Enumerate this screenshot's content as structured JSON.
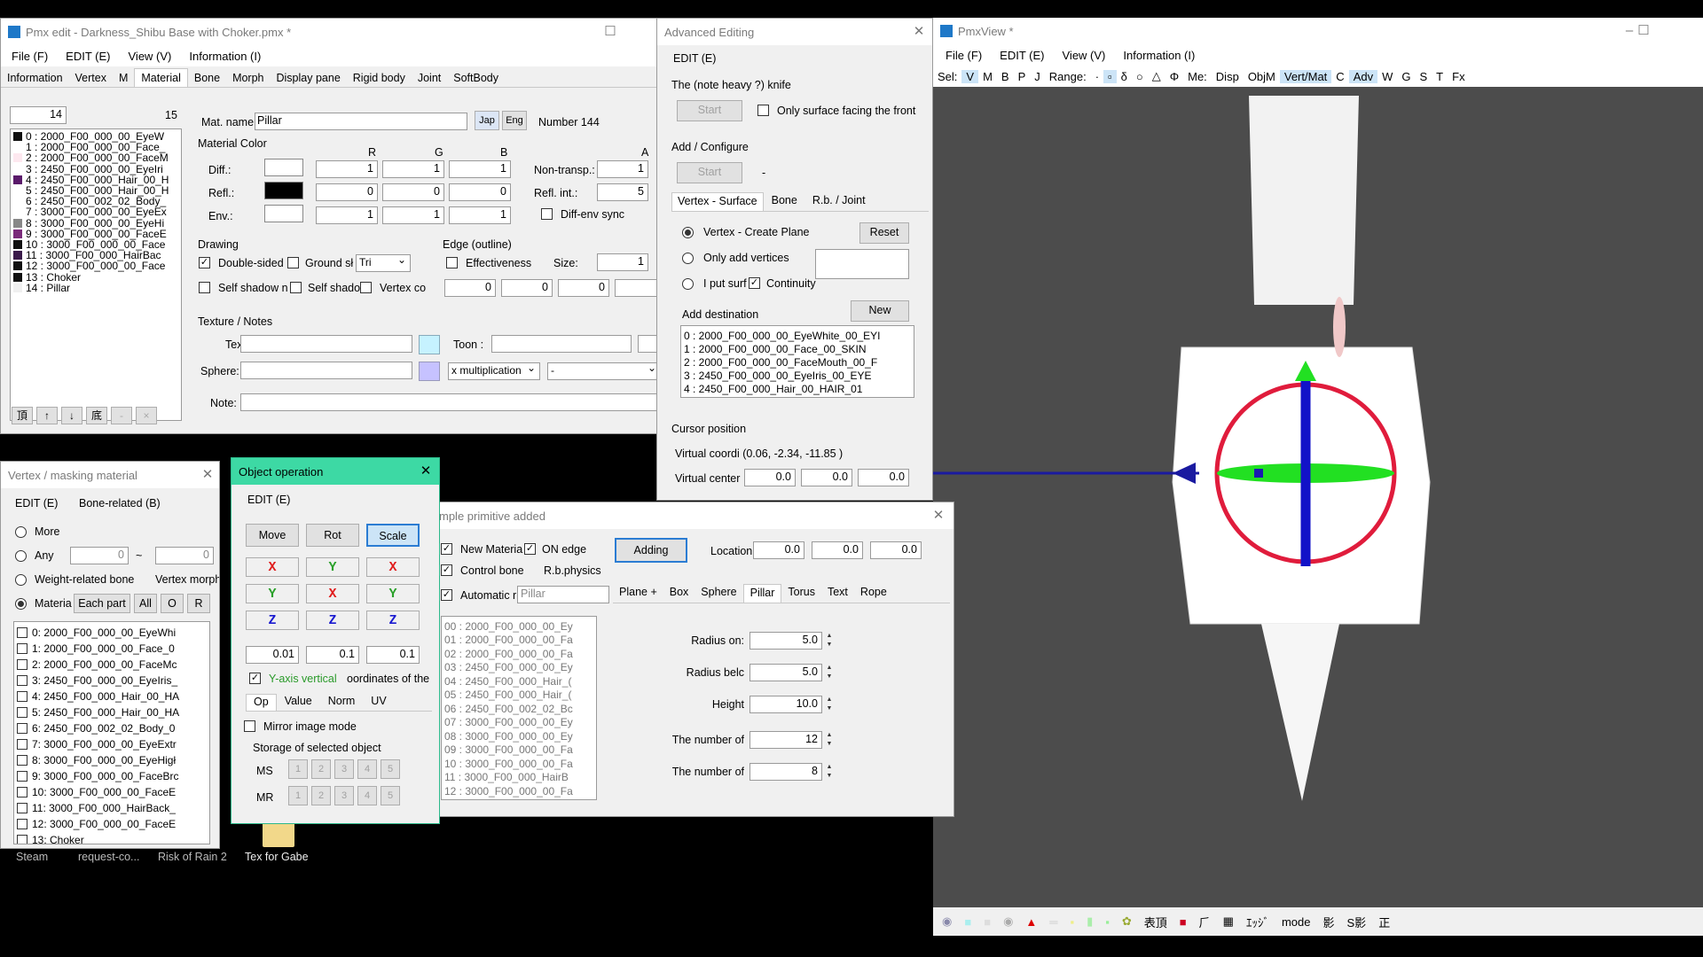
{
  "pmx": {
    "title": "Pmx edit - Darkness_Shibu Base with Choker.pmx *",
    "menu": [
      "File (F)",
      "EDIT (E)",
      "View (V)",
      "Information (I)"
    ],
    "tabs": [
      "Information",
      "Vertex",
      "M",
      "Material",
      "Bone",
      "Morph",
      "Display pane",
      "Rigid body",
      "Joint",
      "SoftBody"
    ],
    "index_box": "14",
    "count": "15",
    "mat_label": "Mat. name",
    "mat_name": "Pillar",
    "jap": "Jap",
    "eng": "Eng",
    "number": "Number 144",
    "color_title": "Material Color",
    "r": "R",
    "g": "G",
    "b": "B",
    "a": "A",
    "diff": "Diff.:",
    "refl": "Refl.:",
    "env": "Env.:",
    "diff_vals": [
      "1",
      "1",
      "1"
    ],
    "refl_vals": [
      "0",
      "0",
      "0"
    ],
    "env_vals": [
      "1",
      "1",
      "1"
    ],
    "nontransp": "Non-transp.:",
    "nontransp_val": "1",
    "reflint": "Refl. int.:",
    "reflint_val": "5",
    "diffenv": "Diff-env sync",
    "drawing": "Drawing",
    "doublesided": "Double-sided",
    "ground": "Ground sł",
    "tri": "Tri",
    "selfshadow": "Self shadow n",
    "selfshadow2": "Self shado",
    "vertexco": "Vertex co",
    "edge": "Edge (outline)",
    "effect": "Effectiveness",
    "size": "Size:",
    "size_val": "1",
    "edge_vals": [
      "0",
      "0",
      "0"
    ],
    "texnotes": "Texture / Notes",
    "tex": "Tex :",
    "toon": "Toon :",
    "sphere": "Sphere:",
    "mult": "x multiplication",
    "dash": "-",
    "note": "Note:",
    "materials": [
      {
        "t": "0 : 2000_F00_000_00_EyeW",
        "c": "#111111"
      },
      {
        "t": "1 : 2000_F00_000_00_Face_",
        "c": "#ffffff"
      },
      {
        "t": "2 : 2000_F00_000_00_FaceM",
        "c": "#fde8ef"
      },
      {
        "t": "3 : 2450_F00_000_00_EyeIri",
        "c": "#ffffff"
      },
      {
        "t": "4 : 2450_F00_000_Hair_00_H",
        "c": "#5a1a6a"
      },
      {
        "t": "5 : 2450_F00_000_Hair_00_H",
        "c": "#ffffff"
      },
      {
        "t": "6 : 2450_F00_002_02_Body_",
        "c": "#ffffff"
      },
      {
        "t": "7 : 3000_F00_000_00_EyeEx",
        "c": "#ffffff"
      },
      {
        "t": "8 : 3000_F00_000_00_EyeHi",
        "c": "#888888"
      },
      {
        "t": "9 : 3000_F00_000_00_FaceE",
        "c": "#7a2a7a"
      },
      {
        "t": "10 : 3000_F00_000_00_Face",
        "c": "#111111"
      },
      {
        "t": "11 : 3000_F00_000_HairBac",
        "c": "#3a1a4a"
      },
      {
        "t": "12 : 3000_F00_000_00_Face",
        "c": "#111111"
      },
      {
        "t": "13 : Choker",
        "c": "#111111"
      },
      {
        "t": "14 : Pillar",
        "c": "#f0f0f0"
      }
    ],
    "bottom_btns": [
      "頂",
      "↑",
      "↓",
      "底",
      "-",
      "×"
    ]
  },
  "adv": {
    "title": "Advanced Editing",
    "menu": "EDIT (E)",
    "knife": "The (note heavy ?) knife",
    "start": "Start",
    "surface": "Only surface facing the front",
    "addconf": "Add / Configure",
    "start2": "Start",
    "dash": "-",
    "tabs": [
      "Vertex - Surface",
      "Bone",
      "R.b. / Joint"
    ],
    "createplane": "Vertex - Create Plane",
    "reset": "Reset",
    "onlyadd": "Only add vertices",
    "iput": "I put surf",
    "continuity": "Continuity",
    "adddest": "Add destination",
    "new": "New",
    "dest": [
      "0 : 2000_F00_000_00_EyeWhite_00_EYI",
      "1 : 2000_F00_000_00_Face_00_SKIN",
      "2 : 2000_F00_000_00_FaceMouth_00_F",
      "3 : 2450_F00_000_00_EyeIris_00_EYE",
      "4 : 2450_F00_000_Hair_00_HAIR_01"
    ],
    "cursor": "Cursor position",
    "virtual": "Virtual coordi (0.06, -2.34, -11.85 )",
    "vcenter": "Virtual center",
    "vc": [
      "0.0",
      "0.0",
      "0.0"
    ]
  },
  "view": {
    "title": "PmxView *",
    "menu": [
      "File (F)",
      "EDIT (E)",
      "View (V)",
      "Information (I)"
    ],
    "tools": [
      "Sel:",
      "V",
      "M",
      "B",
      "P",
      "J",
      "Range:",
      "·",
      "▫",
      "δ",
      "○",
      "△",
      "Φ",
      "Me:",
      "Disp",
      "ObjM",
      "Vert/Mat",
      "C",
      "Adv",
      "W",
      "G",
      "S",
      "T",
      "Fx"
    ],
    "status": [
      "表頂",
      "ｴｯｼﾞ",
      "mode",
      "影",
      "S影",
      "正"
    ]
  },
  "mask": {
    "title": "Vertex / masking material",
    "menu": [
      "EDIT (E)",
      "Bone-related (B)"
    ],
    "more": "More",
    "any": "Any",
    "any_v1": "0",
    "tilde": "~",
    "any_v2": "0",
    "weight": "Weight-related bone",
    "vmorph": "Vertex morph",
    "materia": "Materia",
    "eachpart": "Each part",
    "all": "All",
    "o": "O",
    "r": "R",
    "items": [
      "0: 2000_F00_000_00_EyeWhi",
      "1: 2000_F00_000_00_Face_0",
      "2: 2000_F00_000_00_FaceMc",
      "3: 2450_F00_000_00_EyeIris_",
      "4: 2450_F00_000_Hair_00_HA",
      "5: 2450_F00_000_Hair_00_HA",
      "6: 2450_F00_002_02_Body_0",
      "7: 3000_F00_000_00_EyeExtr",
      "8: 3000_F00_000_00_EyeHigł",
      "9: 3000_F00_000_00_FaceBrc",
      "10: 3000_F00_000_00_FaceE",
      "11: 3000_F00_000_HairBack_",
      "12: 3000_F00_000_00_FaceE",
      "13: Choker"
    ]
  },
  "obj": {
    "title": "Object operation",
    "menu": "EDIT (E)",
    "move": "Move",
    "rot": "Rot",
    "scale": "Scale",
    "axes": [
      [
        "X",
        "Y",
        "X"
      ],
      [
        "Y",
        "X",
        "Y"
      ],
      [
        "Z",
        "Z",
        "Z"
      ]
    ],
    "vals": [
      "0.01",
      "0.1",
      "0.1"
    ],
    "yaxis": "Y-axis vertical",
    "coords": "oordinates of the",
    "tabs": [
      "Op",
      "Value",
      "Norm",
      "UV"
    ],
    "mirror": "Mirror image mode",
    "storage": "Storage of selected object",
    "ms": "MS",
    "mr": "MR",
    "nums": [
      "1",
      "2",
      "3",
      "4",
      "5"
    ]
  },
  "prim": {
    "title": "mple primitive added",
    "newmat": "New Materia",
    "onedge": "ON edge",
    "adding": "Adding",
    "location": "Location",
    "loc": [
      "0.0",
      "0.0",
      "0.0"
    ],
    "ctrlbone": "Control bone",
    "rbphys": "R.b.physics",
    "auto": "Automatic r",
    "pillar": "Pillar",
    "tabs": [
      "Plane +",
      "Box",
      "Sphere",
      "Pillar",
      "Torus",
      "Text",
      "Rope"
    ],
    "list": [
      "00 : 2000_F00_000_00_Ey",
      "01 : 2000_F00_000_00_Fa",
      "02 : 2000_F00_000_00_Fa",
      "03 : 2450_F00_000_00_Ey",
      "04 : 2450_F00_000_Hair_(",
      "05 : 2450_F00_000_Hair_(",
      "06 : 2450_F00_002_02_Bc",
      "07 : 3000_F00_000_00_Ey",
      "08 : 3000_F00_000_00_Ey",
      "09 : 3000_F00_000_00_Fa",
      "10 : 3000_F00_000_00_Fa",
      "11 : 3000_F00_000_HairB",
      "12 : 3000_F00_000_00_Fa"
    ],
    "params": [
      {
        "l": "Radius on:",
        "v": "5.0"
      },
      {
        "l": "Radius belc",
        "v": "5.0"
      },
      {
        "l": "Height",
        "v": "10.0"
      },
      {
        "l": "The number of",
        "v": "12"
      },
      {
        "l": "The number of",
        "v": "8"
      }
    ]
  },
  "desktop": {
    "steam": "Steam",
    "request": "request-co...",
    "risk": "Risk of Rain 2",
    "tex": "Tex for Gabe"
  }
}
